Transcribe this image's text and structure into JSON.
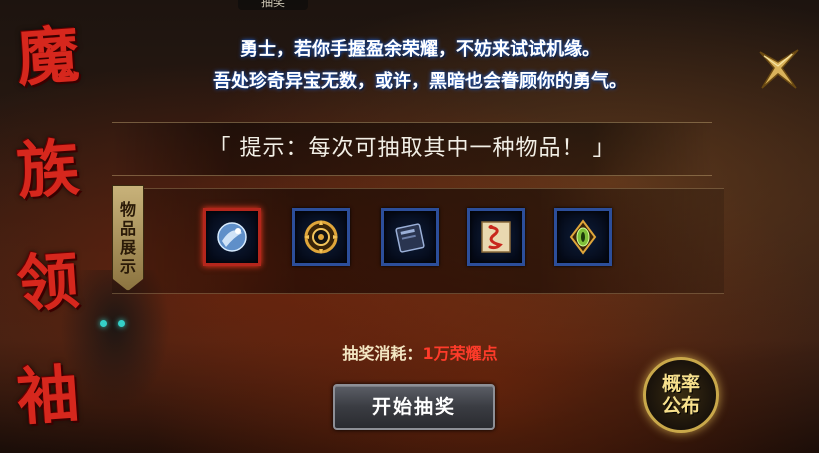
{
  "top_tab": {
    "label": "抽奖"
  },
  "side_title": [
    "魔",
    "族",
    "领",
    "袖"
  ],
  "intro": {
    "line1": "勇士，若你手握盈余荣耀，不妨来试试机缘。",
    "line2": "吾处珍奇异宝无数，或许，黑暗也会眷顾你的勇气。"
  },
  "hint": {
    "text": "「 提示：每次可抽取其中一种物品！ 」"
  },
  "showcase": {
    "label_chars": [
      "物",
      "品",
      "展",
      "示"
    ],
    "items": [
      {
        "icon": "crystal-orb-icon",
        "selected": true,
        "accent": "#8fb8e6"
      },
      {
        "icon": "golden-medallion-icon",
        "selected": false,
        "accent": "#e0a63a"
      },
      {
        "icon": "dark-tome-icon",
        "selected": false,
        "accent": "#6c7fa8"
      },
      {
        "icon": "serpent-scroll-icon",
        "selected": false,
        "accent": "#c8271d"
      },
      {
        "icon": "green-gem-amulet-icon",
        "selected": false,
        "accent": "#7fc13a"
      }
    ]
  },
  "cost": {
    "label": "抽奖消耗：",
    "value": "1万荣耀点"
  },
  "start_button": {
    "label": "开始抽奖"
  },
  "probability_badge": {
    "line1": "概率",
    "line2": "公布"
  },
  "colors": {
    "title_red": "#d6271d",
    "cost_red": "#ff3b2a",
    "slot_blue": "#2c4e9a",
    "slot_selected": "#b4261c",
    "gold": "#c9a84a"
  }
}
